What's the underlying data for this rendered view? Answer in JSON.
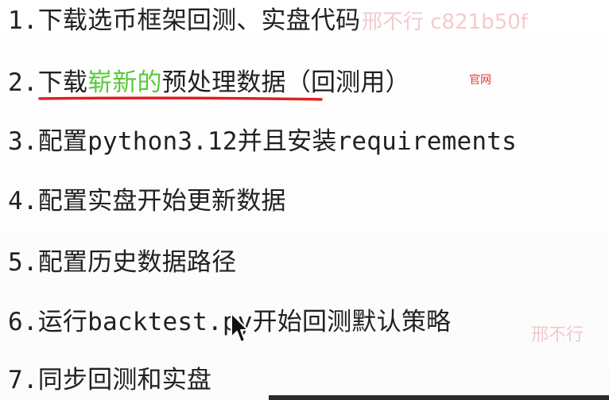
{
  "steps": [
    {
      "num": "1.",
      "text": "下载选币框架回测、实盘代码"
    },
    {
      "num": "2.",
      "text_pre": "下载",
      "text_highlight": "崭新的",
      "text_post": "预处理数据（回测用）",
      "note": "官网"
    },
    {
      "num": "3.",
      "text": "配置python3.12并且安装requirements"
    },
    {
      "num": "4.",
      "text": "配置实盘开始更新数据"
    },
    {
      "num": "5.",
      "text": "配置历史数据路径"
    },
    {
      "num": "6.",
      "text": "运行backtest.py开始回测默认策略"
    },
    {
      "num": "7.",
      "text": "同步回测和实盘"
    }
  ],
  "watermark": {
    "top": "邢不行 c821b50f",
    "bottom": "邢不行"
  },
  "colors": {
    "text": "#202124",
    "highlight": "#59c93a",
    "underline": "#e02020",
    "note": "#e53935"
  },
  "icons": {
    "cursor": "mouse-pointer-icon"
  }
}
